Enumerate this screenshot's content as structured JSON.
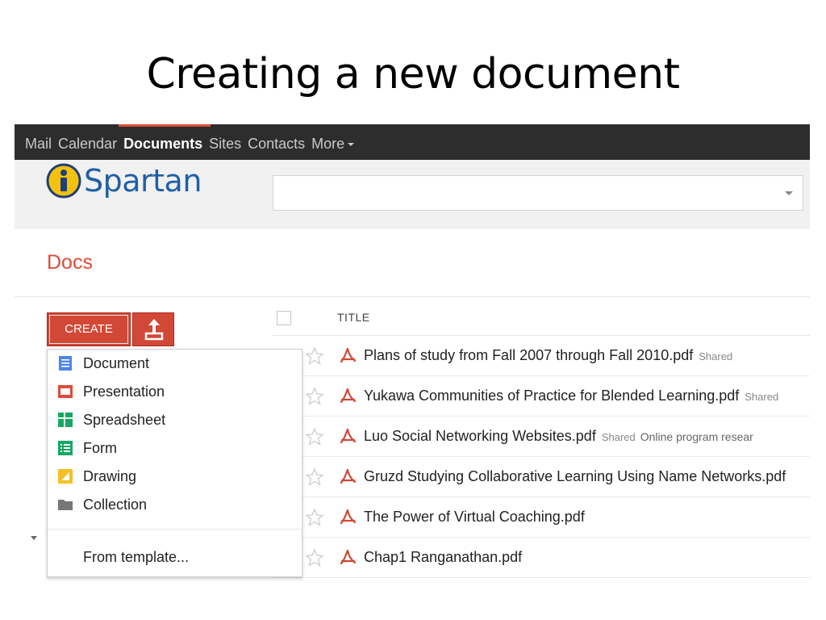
{
  "slide": {
    "title": "Creating a new document"
  },
  "topbar": {
    "nav": [
      {
        "label": "Mail"
      },
      {
        "label": "Calendar"
      },
      {
        "label": "Documents",
        "active": true
      },
      {
        "label": "Sites"
      },
      {
        "label": "Contacts"
      },
      {
        "label": "More"
      }
    ]
  },
  "header": {
    "logo_text": "Spartan",
    "logo_icon": "info-circle-icon",
    "search": {
      "value": "",
      "placeholder": ""
    }
  },
  "docs": {
    "title": "Docs",
    "create_label": "CREATE",
    "upload_icon": "upload-icon"
  },
  "create_menu": {
    "items": [
      {
        "label": "Document",
        "icon": "document-icon",
        "color": "#4a86e8"
      },
      {
        "label": "Presentation",
        "icon": "presentation-icon",
        "color": "#dd4b39"
      },
      {
        "label": "Spreadsheet",
        "icon": "spreadsheet-icon",
        "color": "#16a765"
      },
      {
        "label": "Form",
        "icon": "form-icon",
        "color": "#16a765"
      },
      {
        "label": "Drawing",
        "icon": "drawing-icon",
        "color": "#f6bf26"
      },
      {
        "label": "Collection",
        "icon": "folder-icon",
        "color": "#777777"
      }
    ],
    "template_label": "From template..."
  },
  "file_list": {
    "column_title": "TITLE",
    "rows": [
      {
        "name": "Plans of study from Fall 2007 through Fall 2010.pdf",
        "badge": "Shared",
        "collection": ""
      },
      {
        "name": "Yukawa Communities of Practice for Blended Learning.pdf",
        "badge": "Shared",
        "collection": ""
      },
      {
        "name": "Luo Social Networking Websites.pdf",
        "badge": "Shared",
        "collection": "Online program resear"
      },
      {
        "name": "Gruzd Studying Collaborative Learning Using Name Networks.pdf",
        "badge": "",
        "collection": ""
      },
      {
        "name": "The Power of Virtual Coaching.pdf",
        "badge": "",
        "collection": ""
      },
      {
        "name": "Chap1 Ranganathan.pdf",
        "badge": "",
        "collection": ""
      }
    ]
  },
  "colors": {
    "accent": "#dd4b39",
    "topbar": "#2d2d2d",
    "logo_blue": "#1f5fa6",
    "logo_yellow": "#f4c20d"
  }
}
